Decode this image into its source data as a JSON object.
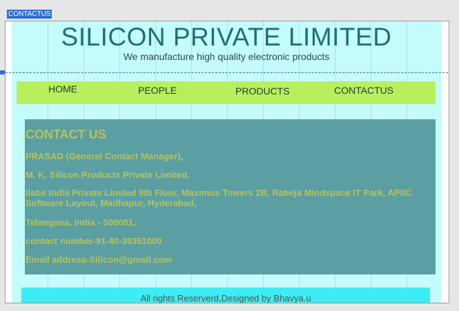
{
  "editor": {
    "selected_tag": "CONTACTUS"
  },
  "header": {
    "title": "SILICON PRIVATE LIMITED",
    "subtitle": "We manufacture high quality electronic products"
  },
  "nav": {
    "items": [
      {
        "label": "HOME"
      },
      {
        "label": "PEOPLE"
      },
      {
        "label": "PRODUCTS"
      },
      {
        "label": "CONTACTUS"
      }
    ]
  },
  "contact": {
    "heading": "CONTACT US",
    "lines": [
      "PRASAD (General Contact Manager),",
      "M. K. Silicon Products Private Limited,",
      "ilabs India Private Limited 9th Floor, Maximus Towers 2B, Raheja Mindspace IT Park, APIIC Software Layout, Madhapur, Hyderabad,",
      "Telangana, India - 500081,",
      "contact number-91-40-39351000",
      "Email address-Silicon@gmail.com"
    ]
  },
  "footer": {
    "text": "All rights Reserverd,Designed by Bhavya.u"
  },
  "colors": {
    "page_background": "#c4fbfb",
    "title": "#1f6f73",
    "nav_background": "#b6f15d",
    "contact_background": "#5b9fa2",
    "contact_text": "#b8c25a",
    "footer_background": "#3eecf3",
    "selection_tag": "#2f6fd6"
  }
}
